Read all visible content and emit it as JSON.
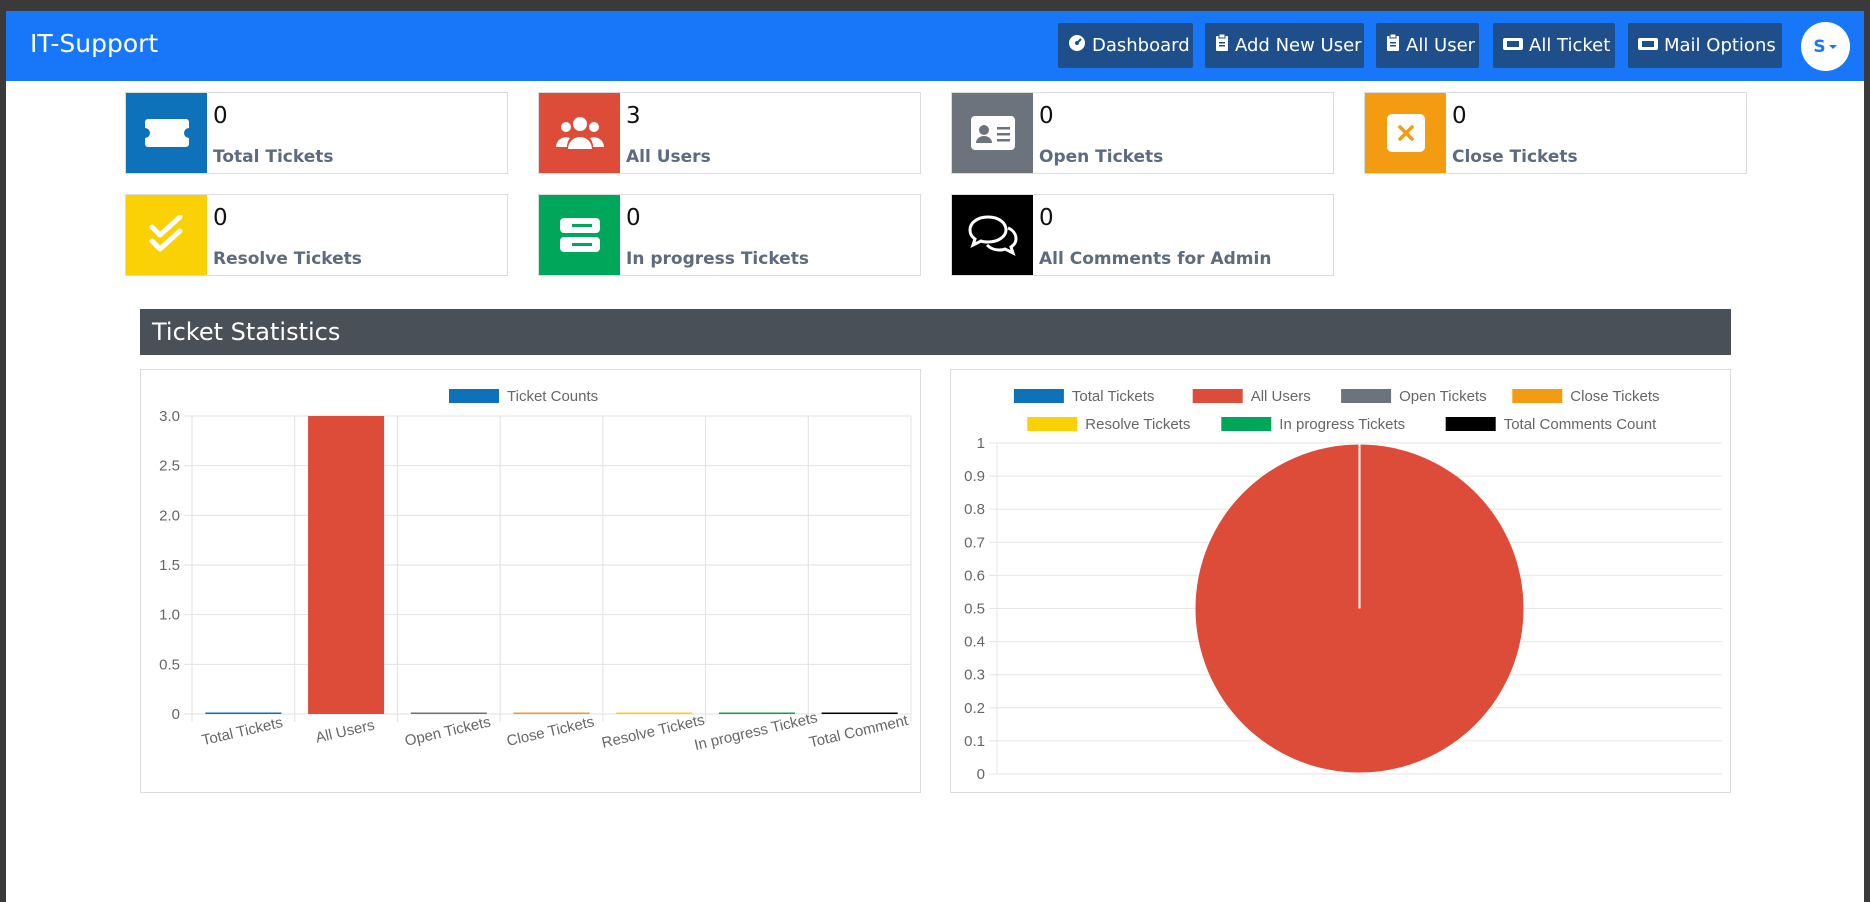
{
  "app": {
    "brand": "IT-Support",
    "avatar_letter": "S"
  },
  "nav": {
    "items": [
      {
        "label": "Dashboard",
        "icon": "dashboard-icon"
      },
      {
        "label": "Add New User",
        "icon": "clipboard-icon"
      },
      {
        "label": "All User",
        "icon": "clipboard-icon"
      },
      {
        "label": "All Ticket",
        "icon": "ticket-icon"
      },
      {
        "label": "Mail Options",
        "icon": "ticket-icon"
      }
    ]
  },
  "cards": [
    {
      "value": "0",
      "label": "Total Tickets",
      "color": "#0d72b9",
      "icon": "ticket-icon"
    },
    {
      "value": "3",
      "label": "All Users",
      "color": "#dd4b39",
      "icon": "users-icon"
    },
    {
      "value": "0",
      "label": "Open Tickets",
      "color": "#6c737c",
      "icon": "id-card-icon"
    },
    {
      "value": "0",
      "label": "Close Tickets",
      "color": "#f39c12",
      "icon": "close-box-icon"
    },
    {
      "value": "0",
      "label": "Resolve Tickets",
      "color": "#f9d104",
      "icon": "double-check-icon"
    },
    {
      "value": "0",
      "label": "In progress Tickets",
      "color": "#00a65a",
      "icon": "server-icon"
    },
    {
      "value": "0",
      "label": "All Comments for Admin",
      "color": "#000000",
      "icon": "comments-icon"
    }
  ],
  "stats": {
    "title": "Ticket Statistics"
  },
  "chart_data": [
    {
      "type": "bar",
      "legend": [
        "Ticket Counts"
      ],
      "categories": [
        "Total Tickets",
        "All Users",
        "Open Tickets",
        "Close Tickets",
        "Resolve Tickets",
        "In progress Tickets",
        "Total Comment"
      ],
      "series": [
        {
          "name": "Ticket Counts",
          "values": [
            0,
            3,
            0,
            0,
            0,
            0,
            0
          ]
        }
      ],
      "colors": [
        "#0d72b9",
        "#dd4b39",
        "#6c737c",
        "#f39c12",
        "#f9d104",
        "#00a65a",
        "#000000"
      ],
      "yticks": [
        "0",
        "0.5",
        "1.0",
        "1.5",
        "2.0",
        "2.5",
        "3.0"
      ],
      "ylim": [
        0,
        3
      ],
      "grid": true,
      "legend_position": "top"
    },
    {
      "type": "pie",
      "legend": [
        "Total Tickets",
        "All Users",
        "Open Tickets",
        "Close Tickets",
        "Resolve Tickets",
        "In progress Tickets",
        "Total Comments Count"
      ],
      "values": [
        0,
        3,
        0,
        0,
        0,
        0,
        0
      ],
      "colors": [
        "#0d72b9",
        "#dd4b39",
        "#6c737c",
        "#f39c12",
        "#f9d104",
        "#00a65a",
        "#000000"
      ],
      "yticks": [
        "0",
        "0.1",
        "0.2",
        "0.3",
        "0.4",
        "0.5",
        "0.6",
        "0.7",
        "0.8",
        "0.9",
        "1"
      ],
      "ylim": [
        0,
        1
      ],
      "grid": true,
      "legend_position": "top"
    }
  ]
}
